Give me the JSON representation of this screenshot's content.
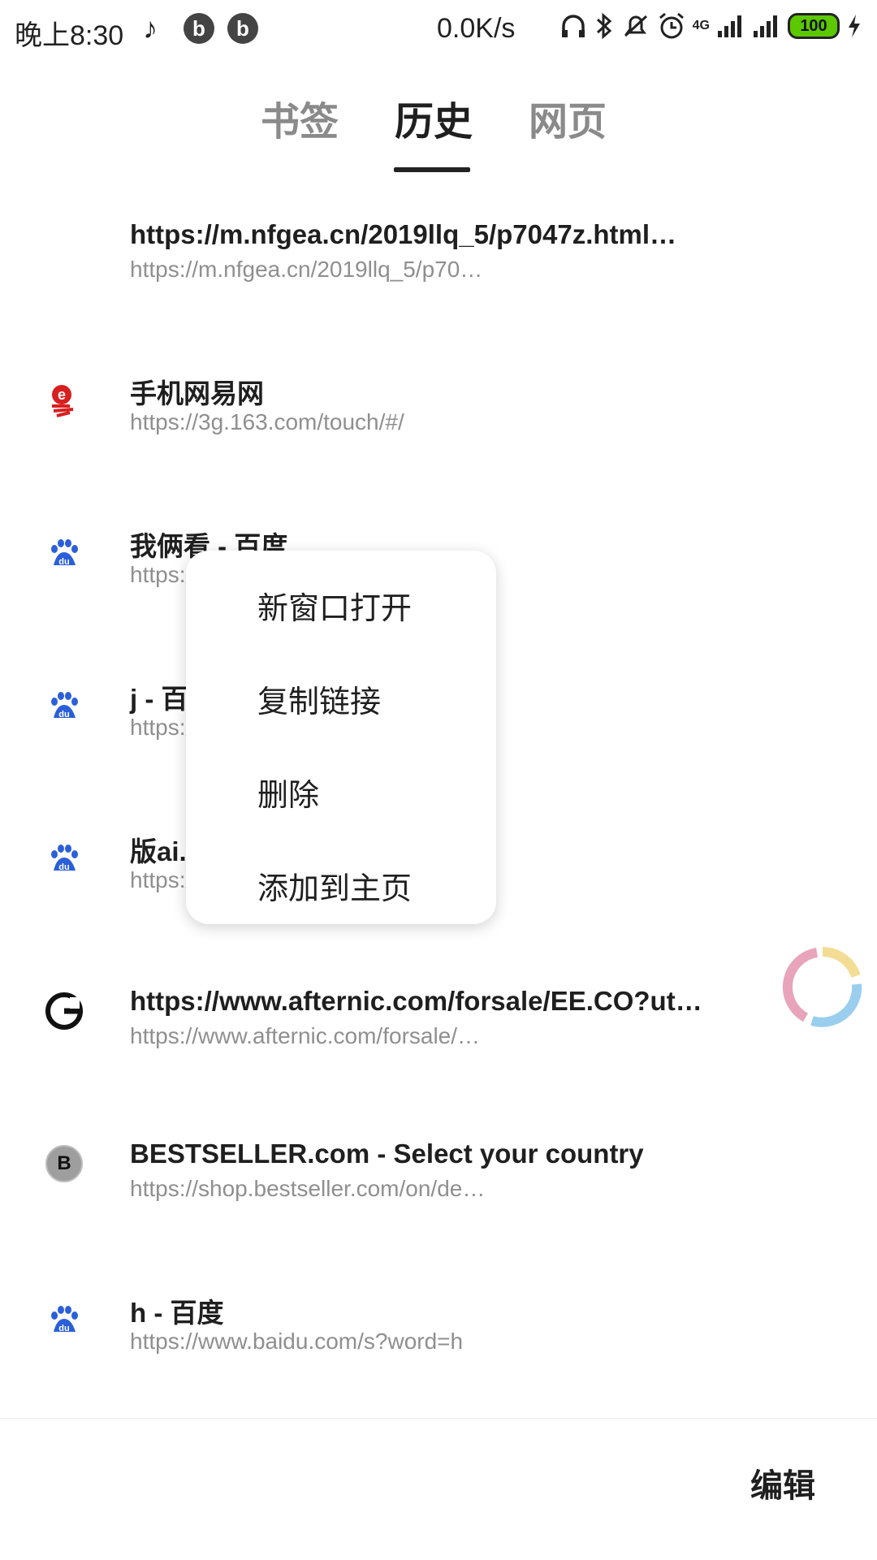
{
  "status_bar": {
    "time": "晚上8:30",
    "speed": "0.0K/s",
    "network": "4G",
    "battery": "100",
    "icons": [
      "music-note-icon",
      "b-app-icon",
      "b-app-icon",
      "headphones-icon",
      "bluetooth-icon",
      "mute-icon",
      "alarm-icon",
      "signal-icon",
      "signal-icon",
      "battery-icon",
      "charging-icon"
    ]
  },
  "tabs": [
    {
      "label": "书签"
    },
    {
      "label": "历史"
    },
    {
      "label": "网页"
    }
  ],
  "history": [
    {
      "title": "https://m.nfgea.cn/2019llq_5/p7047z.html…",
      "url": "https://m.nfgea.cn/2019llq_5/p70…",
      "icon": "none"
    },
    {
      "title": "手机网易网",
      "url": "https://3g.163.com/touch/#/",
      "icon": "netease-icon"
    },
    {
      "title": "我俩看 - 百度",
      "url": "https://www.baidu.com/s?word=…",
      "icon": "baidu-icon"
    },
    {
      "title": "j - 百度",
      "url": "https://www.baidu.com/s?word=j",
      "icon": "baidu-icon"
    },
    {
      "title": "版ai.",
      "url": "https://www.baidu.com/s?word=…",
      "icon": "baidu-icon"
    },
    {
      "title": "https://www.afternic.com/forsale/EE.CO?ut…",
      "url": "https://www.afternic.com/forsale/…",
      "icon": "g-icon"
    },
    {
      "title": "BESTSELLER.com - Select your country",
      "url": "https://shop.bestseller.com/on/de…",
      "icon": "letter-b-icon"
    },
    {
      "title": "h - 百度",
      "url": "https://www.baidu.com/s?word=h",
      "icon": "baidu-icon"
    }
  ],
  "letter_icon": "B",
  "context_menu": {
    "items": [
      "新窗口打开",
      "复制链接",
      "删除",
      "添加到主页"
    ]
  },
  "bottom": {
    "edit_label": "编辑"
  }
}
